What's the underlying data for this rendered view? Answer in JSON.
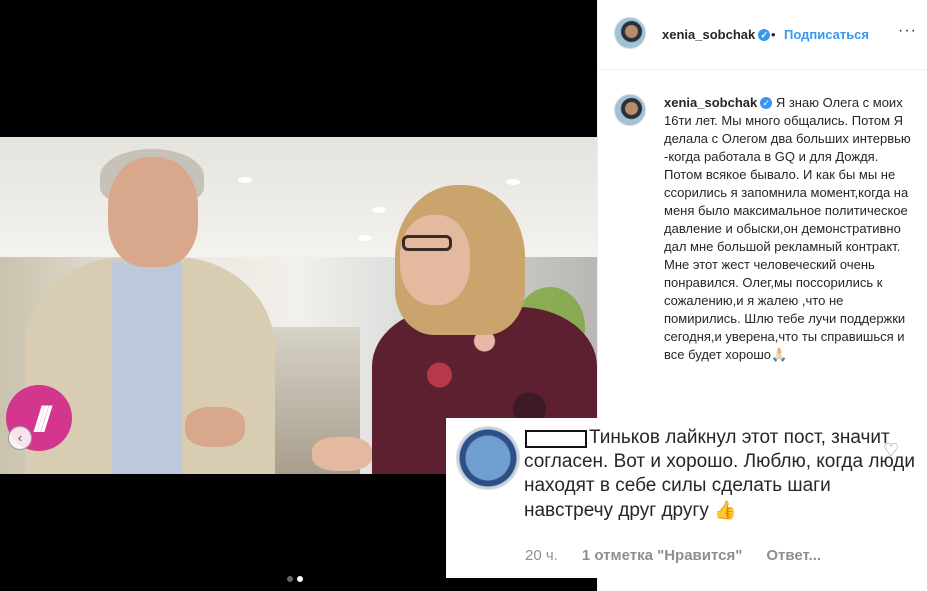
{
  "post": {
    "dots": 2,
    "active_dot": 1
  },
  "logo": {
    "glyph": "///"
  },
  "header": {
    "username": "xenia_sobchak",
    "separator": "•",
    "follow_label": "Подписаться",
    "more_label": "···"
  },
  "caption": {
    "username": "xenia_sobchak",
    "text": "Я знаю Олега с моих 16ти лет. Мы много общались. Потом Я делала с Олегом два больших интервью -когда работала в GQ и для Дождя. Потом всякое бывало. И как бы мы не ссорились я запомнила момент,когда на меня было максимальное политическое давление и обыски,он демонстративно дал мне большой рекламный контракт. Мне этот жест человеческий очень понравился. Олег,мы поссорились к сожалению,и я жалею ,что не помирились. Шлю тебе лучи поддержки сегодня,и уверена,что ты справишься и все будет хорошо🙏🏻"
  },
  "comment": {
    "text": "Тиньков лайкнул этот пост, значит согласен. Вот и хорошо. Люблю, когда люди находят в себе силы сделать шаги навстречу друг другу",
    "emoji": "👍",
    "time": "20 ч.",
    "likes": "1 отметка \"Нравится\"",
    "reply": "Ответ..."
  },
  "colors": {
    "accent": "#3897f0",
    "logo": "#d4358d",
    "text": "#262626",
    "muted": "#8e8e8e"
  },
  "icons": {
    "verified": "verified-badge-icon",
    "heart": "heart-icon",
    "prev": "chevron-left-icon"
  }
}
